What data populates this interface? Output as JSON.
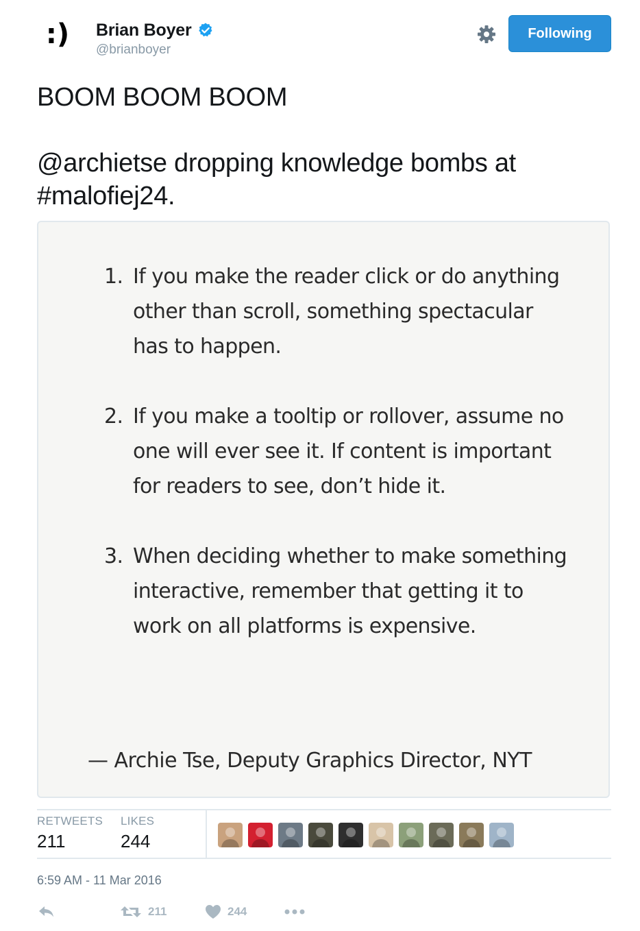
{
  "author": {
    "display_name": "Brian Boyer",
    "handle": "@brianboyer",
    "avatar_text": ":)",
    "verified": true
  },
  "header": {
    "follow_label": "Following",
    "settings_icon": "gear-icon"
  },
  "tweet": {
    "lines": [
      "BOOM BOOM BOOM",
      "@archietse dropping knowledge bombs at #malofiej24."
    ]
  },
  "card": {
    "rules": [
      {
        "num": "1.",
        "text": "If you make the reader click or do anything other than scroll, something spectacular has to happen."
      },
      {
        "num": "2.",
        "text": "If you make a tooltip or rollover, assume no one will ever see it. If content is important for readers to see, don’t hide it."
      },
      {
        "num": "3.",
        "text": "When deciding whether to make something interactive, remember that getting it to work on all platforms is expensive."
      }
    ],
    "attribution": "— Archie Tse, Deputy Graphics Director, NYT"
  },
  "stats": {
    "retweets_label": "RETWEETS",
    "retweets_value": "211",
    "likes_label": "LIKES",
    "likes_value": "244"
  },
  "likers": [
    {
      "color": "#c9a27e"
    },
    {
      "color": "#d32030"
    },
    {
      "color": "#6d7a86"
    },
    {
      "color": "#4a4a3c"
    },
    {
      "color": "#2f2f2f"
    },
    {
      "color": "#d8c4a8"
    },
    {
      "color": "#8ca07a"
    },
    {
      "color": "#6b6b58"
    },
    {
      "color": "#8a7a5a"
    },
    {
      "color": "#9fb4c8"
    }
  ],
  "timestamp": "6:59 AM - 11 Mar 2016",
  "actions": {
    "retweet_count": "211",
    "like_count": "244"
  },
  "colors": {
    "accent": "#2b90d9",
    "verified": "#1da1f2",
    "muted": "#8899a6"
  }
}
